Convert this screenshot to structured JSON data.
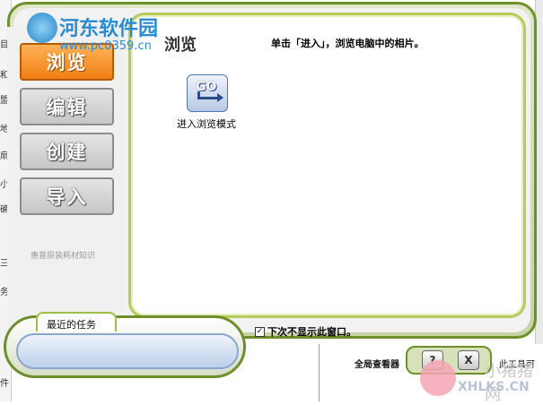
{
  "window": {
    "page_title": "浏览",
    "instruction": "单击「进入」，浏览电脑中的相片。"
  },
  "nav": {
    "items": [
      {
        "label": "浏览",
        "active": true
      },
      {
        "label": "编辑",
        "active": false
      },
      {
        "label": "创建",
        "active": false
      },
      {
        "label": "导入",
        "active": false
      }
    ],
    "note": "惠普原装耗材知识"
  },
  "content": {
    "go_icon_text": "GO",
    "go_label": "进入浏览模式"
  },
  "footer": {
    "recent_tasks_label": "最近的任务",
    "dont_show_label": "下次不显示此窗口。",
    "dont_show_checked": true,
    "help_button": "?",
    "close_button": "X"
  },
  "background": {
    "bottom_text": "全局查看器",
    "bottom_text_right": "此工具可",
    "left_glyphs": [
      "目",
      "和",
      "盟",
      "地",
      "扇",
      "小",
      "确",
      "三",
      "务",
      "件"
    ]
  },
  "watermark": {
    "logo_text": "河东软件园",
    "logo_url": "www.pc0359.cn",
    "corner_text": "小猪猪网",
    "corner_url": "XHLKS.CN"
  },
  "colors": {
    "frame_green": "#6f8f2a",
    "active_orange": "#f17f12",
    "content_border": "#b5cc5a"
  }
}
